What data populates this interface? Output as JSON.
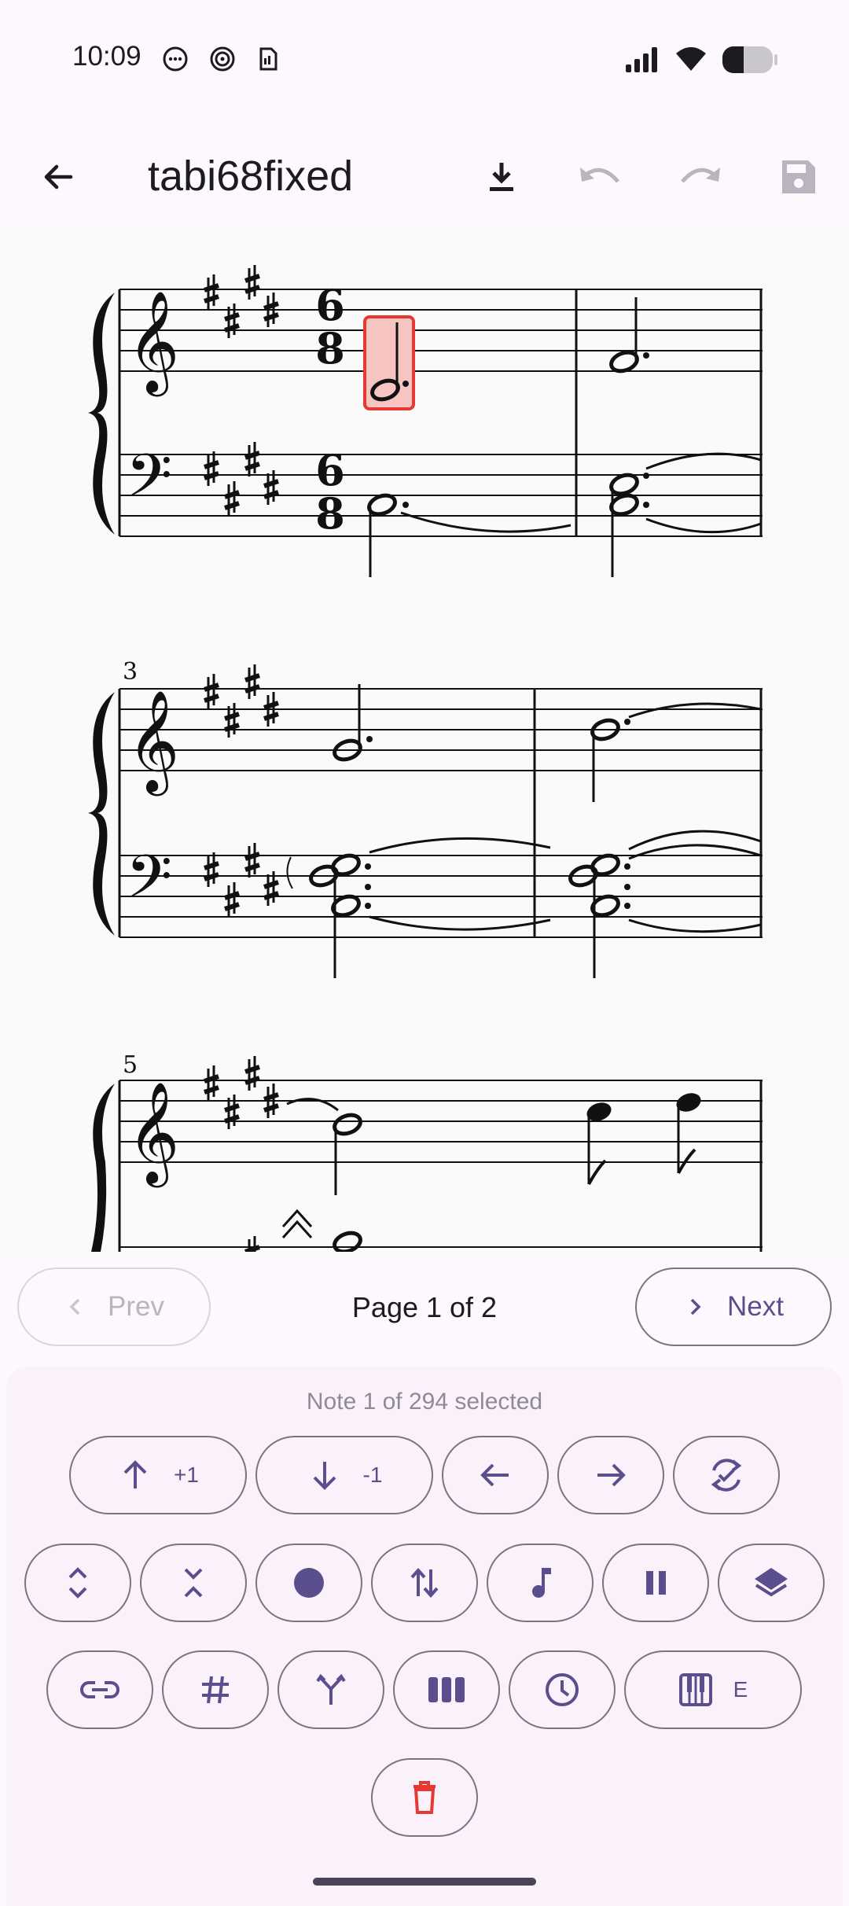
{
  "status_bar": {
    "time": "10:09"
  },
  "app_bar": {
    "title": "tabi68fixed"
  },
  "score": {
    "measure_numbers": [
      "3",
      "5"
    ],
    "time_signature": {
      "top": "6",
      "bottom": "8"
    }
  },
  "pager": {
    "prev_label": "Prev",
    "next_label": "Next",
    "page_label": "Page 1 of 2"
  },
  "panel": {
    "selection_text": "Note 1 of 294 selected",
    "row1": {
      "up_label": "+1",
      "down_label": "-1"
    },
    "row3": {
      "key_label": "E"
    }
  },
  "colors": {
    "accent": "#5b4e8c",
    "selection": "#e53935",
    "delete": "#e53935"
  }
}
